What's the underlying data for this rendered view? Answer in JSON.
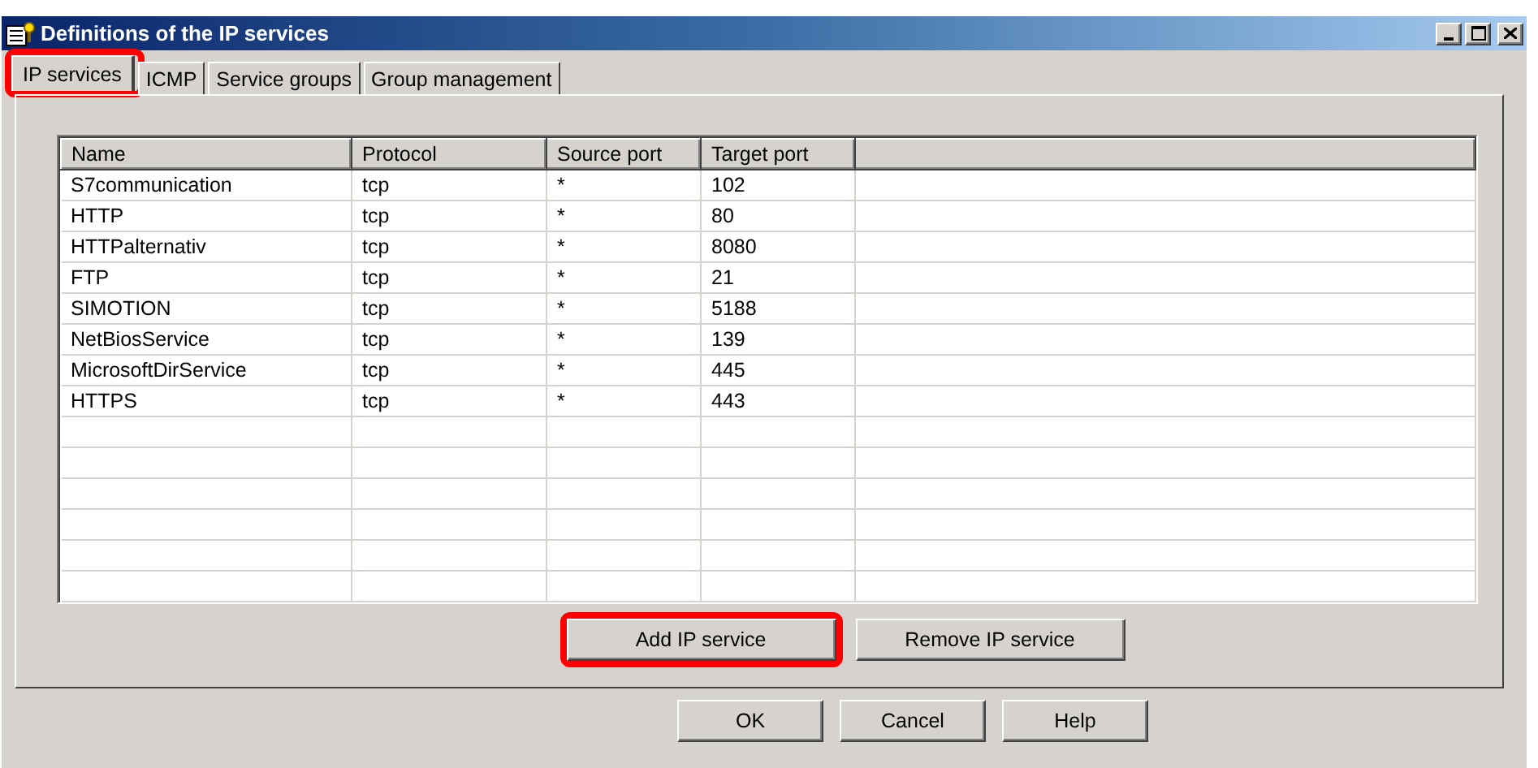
{
  "window": {
    "title": "Definitions of the IP services"
  },
  "tabs": [
    {
      "label": "IP services",
      "selected": true,
      "highlighted": true
    },
    {
      "label": "ICMP",
      "selected": false,
      "highlighted": false
    },
    {
      "label": "Service groups",
      "selected": false,
      "highlighted": false
    },
    {
      "label": "Group management",
      "selected": false,
      "highlighted": false
    }
  ],
  "table": {
    "columns": [
      "Name",
      "Protocol",
      "Source port",
      "Target port"
    ],
    "rows": [
      [
        "S7communication",
        "tcp",
        "*",
        "102"
      ],
      [
        "HTTP",
        "tcp",
        "*",
        "80"
      ],
      [
        "HTTPalternativ",
        "tcp",
        "*",
        "8080"
      ],
      [
        "FTP",
        "tcp",
        "*",
        "21"
      ],
      [
        "SIMOTION",
        "tcp",
        "*",
        "5188"
      ],
      [
        "NetBiosService",
        "tcp",
        "*",
        "139"
      ],
      [
        "MicrosoftDirService",
        "tcp",
        "*",
        "445"
      ],
      [
        "HTTPS",
        "tcp",
        "*",
        "443"
      ]
    ]
  },
  "panel_buttons": [
    {
      "label": "Add IP service",
      "highlighted": true
    },
    {
      "label": "Remove IP service",
      "highlighted": false
    }
  ],
  "dialog_buttons": [
    "OK",
    "Cancel",
    "Help"
  ]
}
